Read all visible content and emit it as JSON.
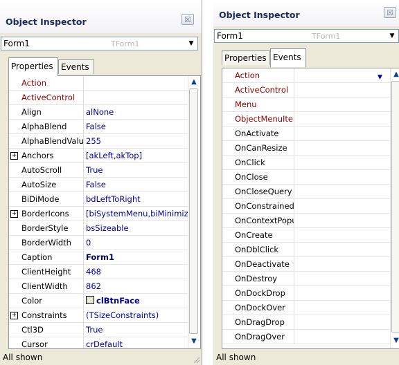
{
  "left": {
    "title": "Object Inspector",
    "close_glyph": "☒",
    "combo": {
      "value": "Form1",
      "type": "TForm1"
    },
    "tabs": [
      "Properties",
      "Events"
    ],
    "status": "All shown",
    "rows": [
      {
        "name": "Action",
        "value": "",
        "kind": "event"
      },
      {
        "name": "ActiveControl",
        "value": "",
        "kind": "event"
      },
      {
        "name": "Align",
        "value": "alNone",
        "kind": "prop"
      },
      {
        "name": "AlphaBlend",
        "value": "False",
        "kind": "prop"
      },
      {
        "name": "AlphaBlendValu",
        "value": "255",
        "kind": "prop"
      },
      {
        "name": "Anchors",
        "value": "[akLeft,akTop]",
        "kind": "prop",
        "expand": "+"
      },
      {
        "name": "AutoScroll",
        "value": "True",
        "kind": "prop"
      },
      {
        "name": "AutoSize",
        "value": "False",
        "kind": "prop"
      },
      {
        "name": "BiDiMode",
        "value": "bdLeftToRight",
        "kind": "prop"
      },
      {
        "name": "BorderIcons",
        "value": "[biSystemMenu,biMinimiz",
        "kind": "prop",
        "expand": "+"
      },
      {
        "name": "BorderStyle",
        "value": "bsSizeable",
        "kind": "prop"
      },
      {
        "name": "BorderWidth",
        "value": "0",
        "kind": "prop"
      },
      {
        "name": "Caption",
        "value": "Form1",
        "kind": "caption"
      },
      {
        "name": "ClientHeight",
        "value": "468",
        "kind": "prop"
      },
      {
        "name": "ClientWidth",
        "value": "862",
        "kind": "prop"
      },
      {
        "name": "Color",
        "value": "clBtnFace",
        "kind": "color"
      },
      {
        "name": "Constraints",
        "value": "(TSizeConstraints)",
        "kind": "prop",
        "expand": "+"
      },
      {
        "name": "Ctl3D",
        "value": "True",
        "kind": "prop"
      },
      {
        "name": "Cursor",
        "value": "crDefault",
        "kind": "prop"
      }
    ]
  },
  "right": {
    "title": "Object Inspector",
    "close_glyph": "☒",
    "combo": {
      "value": "Form1",
      "type": "TForm1"
    },
    "tabs": [
      "Properties",
      "Events"
    ],
    "status": "All shown",
    "rows": [
      {
        "name": "Action",
        "kind": "event"
      },
      {
        "name": "ActiveControl",
        "kind": "event"
      },
      {
        "name": "Menu",
        "kind": "event"
      },
      {
        "name": "ObjectMenuItem",
        "kind": "event"
      },
      {
        "name": "OnActivate",
        "kind": "prop"
      },
      {
        "name": "OnCanResize",
        "kind": "prop"
      },
      {
        "name": "OnClick",
        "kind": "prop"
      },
      {
        "name": "OnClose",
        "kind": "prop"
      },
      {
        "name": "OnCloseQuery",
        "kind": "prop"
      },
      {
        "name": "OnConstrainedResize",
        "kind": "prop"
      },
      {
        "name": "OnContextPopup",
        "kind": "prop"
      },
      {
        "name": "OnCreate",
        "kind": "prop"
      },
      {
        "name": "OnDblClick",
        "kind": "prop"
      },
      {
        "name": "OnDeactivate",
        "kind": "prop"
      },
      {
        "name": "OnDestroy",
        "kind": "prop"
      },
      {
        "name": "OnDockDrop",
        "kind": "prop"
      },
      {
        "name": "OnDockOver",
        "kind": "prop"
      },
      {
        "name": "OnDragDrop",
        "kind": "prop"
      },
      {
        "name": "OnDragOver",
        "kind": "prop"
      }
    ]
  },
  "icons": {
    "dropdown": "chevron-down-icon",
    "scroll_up": "arrow-up-icon",
    "scroll_down": "arrow-down-icon",
    "close": "close-icon",
    "grip": "resize-grip-icon"
  },
  "colors": {
    "event_name": "#8b0000",
    "value": "#0000a0",
    "panel_bg": "#ece9d8",
    "title": "#1a2a5a"
  }
}
